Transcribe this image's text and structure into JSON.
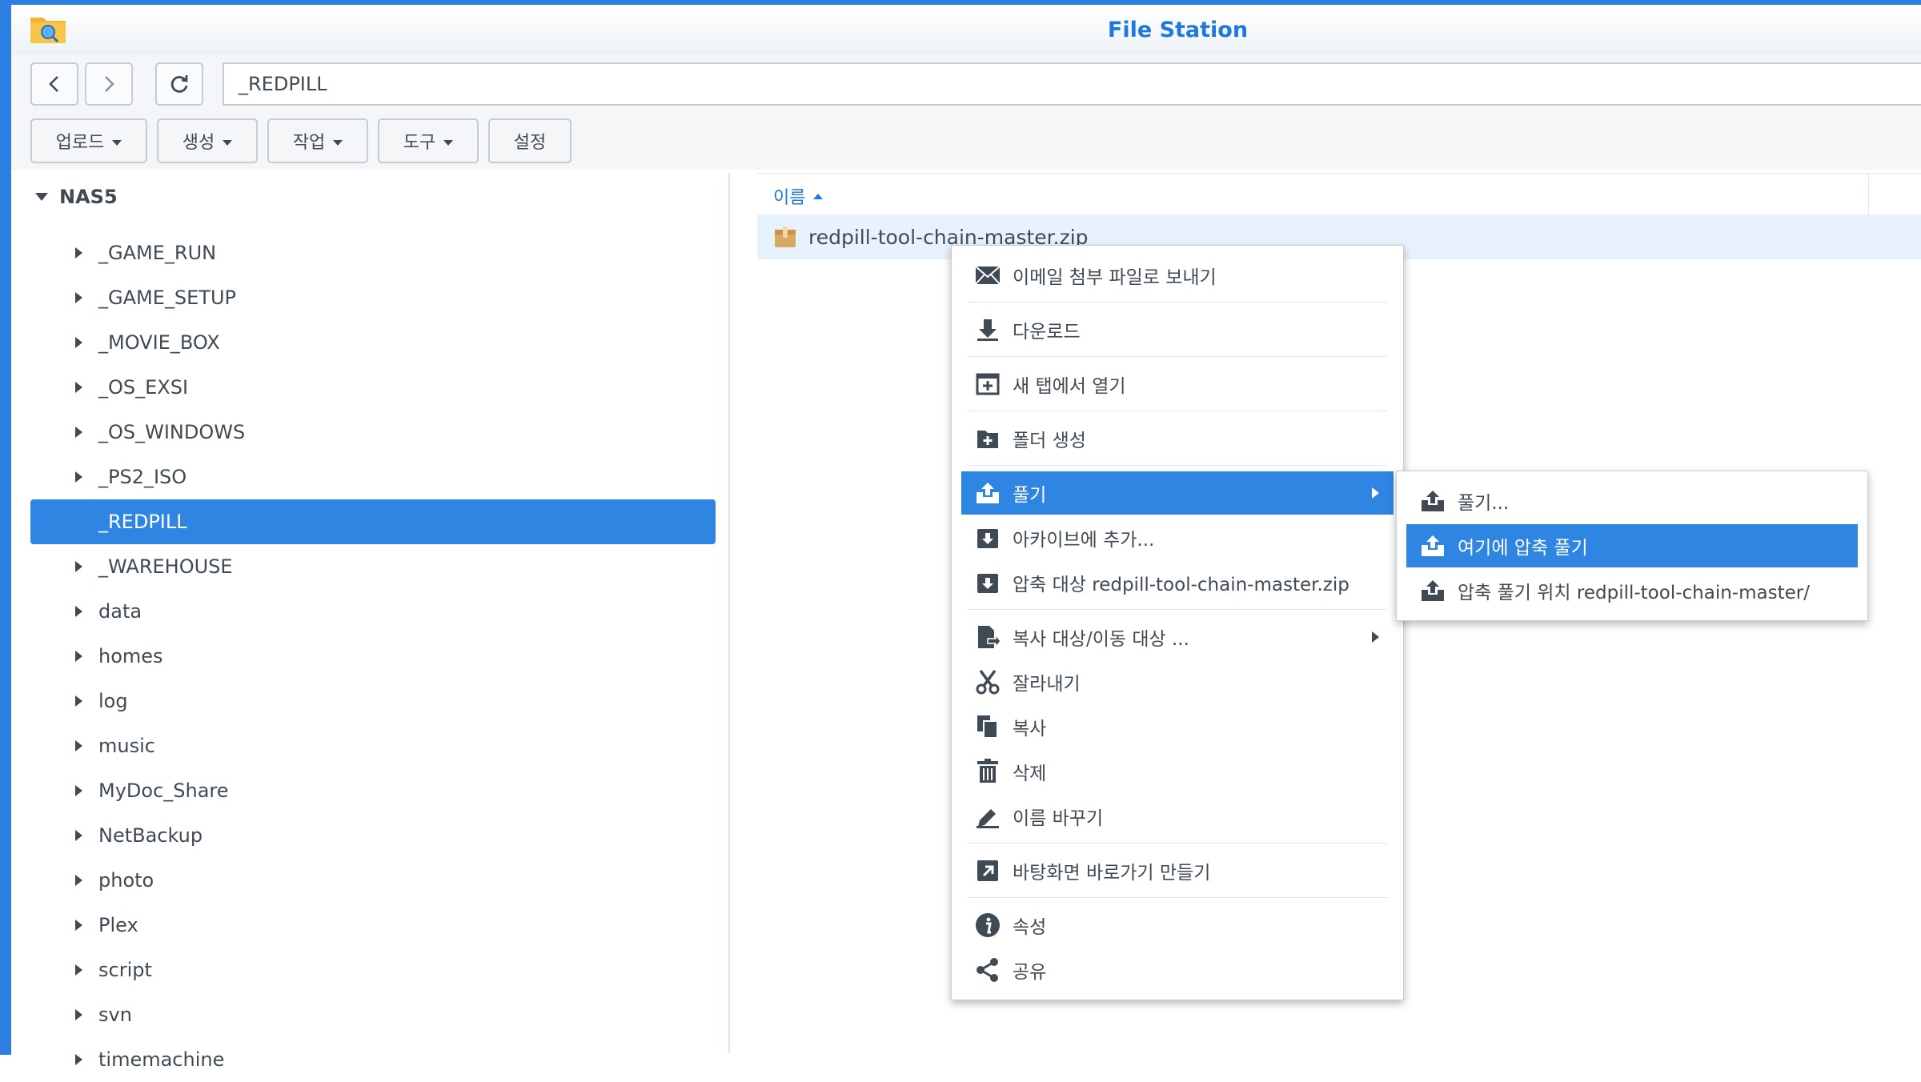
{
  "window": {
    "title": "File Station"
  },
  "nav": {
    "path": "_REDPILL"
  },
  "toolbar": {
    "upload": "업로드",
    "create": "생성",
    "action": "작업",
    "tools": "도구",
    "settings": "설정"
  },
  "tree": {
    "root": "NAS5",
    "items": [
      {
        "label": "_GAME_RUN"
      },
      {
        "label": "_GAME_SETUP"
      },
      {
        "label": "_MOVIE_BOX"
      },
      {
        "label": "_OS_EXSI"
      },
      {
        "label": "_OS_WINDOWS"
      },
      {
        "label": "_PS2_ISO"
      },
      {
        "label": "_REDPILL",
        "selected": true
      },
      {
        "label": "_WAREHOUSE"
      },
      {
        "label": "data"
      },
      {
        "label": "homes"
      },
      {
        "label": "log"
      },
      {
        "label": "music"
      },
      {
        "label": "MyDoc_Share"
      },
      {
        "label": "NetBackup"
      },
      {
        "label": "photo"
      },
      {
        "label": "Plex"
      },
      {
        "label": "script"
      },
      {
        "label": "svn"
      },
      {
        "label": "timemachine"
      }
    ]
  },
  "list": {
    "column_name": "이름",
    "file_name": "redpill-tool-chain-master.zip"
  },
  "context_menu": {
    "email": "이메일 첨부 파일로 보내기",
    "download": "다운로드",
    "open_new_tab": "새 탭에서 열기",
    "create_folder": "폴더 생성",
    "extract": "풀기",
    "add_archive": "아카이브에 추가...",
    "compress_to": "압축 대상 redpill-tool-chain-master.zip",
    "copy_move": "복사 대상/이동 대상 ...",
    "cut": "잘라내기",
    "copy": "복사",
    "delete": "삭제",
    "rename": "이름 바꾸기",
    "desktop_shortcut": "바탕화면 바로가기 만들기",
    "properties": "속성",
    "share": "공유"
  },
  "submenu": {
    "extract_dialog": "풀기...",
    "extract_here": "여기에 압축 풀기",
    "extract_to": "압축 풀기 위치 redpill-tool-chain-master/"
  },
  "colors": {
    "accent": "#2f86e2",
    "title": "#1e7ad8",
    "text": "#404a55"
  }
}
